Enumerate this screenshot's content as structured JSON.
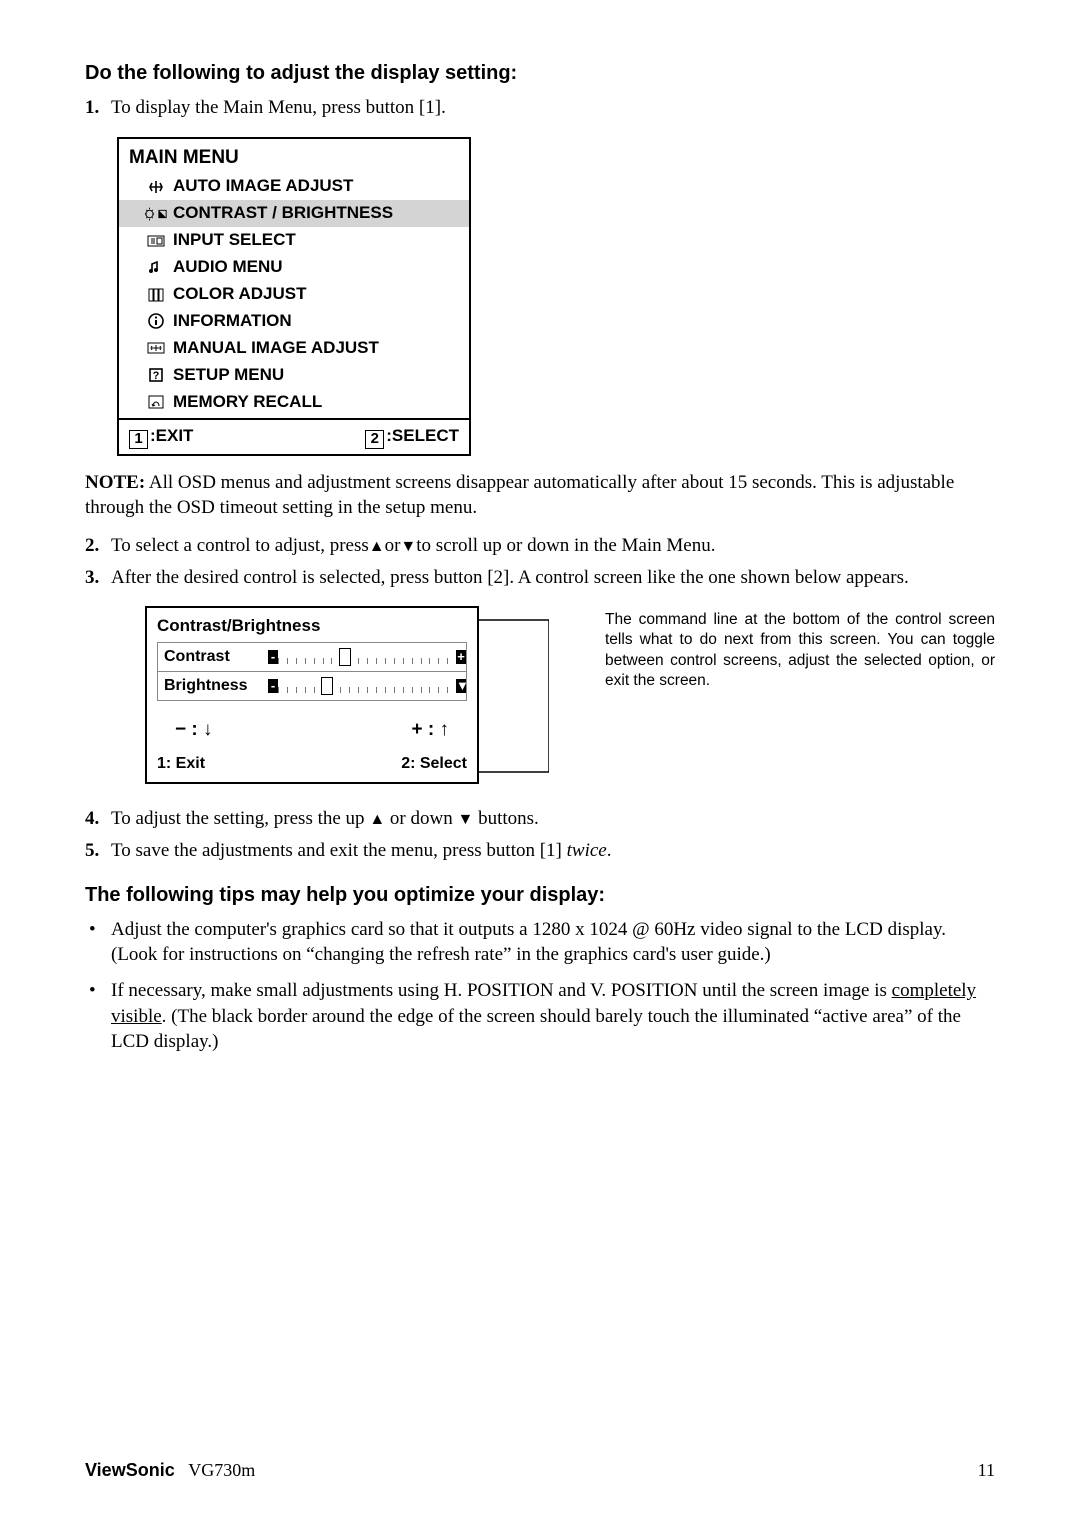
{
  "heading1": "Do the following to adjust the display setting:",
  "step1": {
    "num": "1.",
    "text": "To display the Main Menu, press button [1]."
  },
  "menu": {
    "title": "MAIN MENU",
    "items": [
      "AUTO IMAGE ADJUST",
      "CONTRAST / BRIGHTNESS",
      "INPUT SELECT",
      "AUDIO MENU",
      "COLOR ADJUST",
      "INFORMATION",
      "MANUAL IMAGE ADJUST",
      "SETUP MENU",
      "MEMORY RECALL"
    ],
    "foot_exit_key": "1",
    "foot_exit_label": ":EXIT",
    "foot_select_key": "2",
    "foot_select_label": ":SELECT"
  },
  "note_label": "NOTE:",
  "note_text": " All OSD menus and adjustment screens disappear automatically after about 15 seconds. This is adjustable through the OSD timeout setting in the setup menu.",
  "step2": {
    "num": "2.",
    "pre": "To select a control to adjust, press",
    "mid": "or",
    "post": "to scroll up or down in the Main Menu."
  },
  "step3": {
    "num": "3.",
    "text": "After the desired control is selected, press button [2]. A control screen like the one shown below appears."
  },
  "cb": {
    "title": "Contrast/Brightness",
    "row1": "Contrast",
    "row2": "Brightness",
    "minus": "− : ",
    "plus": "+ : ",
    "foot_exit": "1: Exit",
    "foot_select": "2: Select"
  },
  "cb_note": "The command line at the bottom of the control screen tells what to do next from this screen. You can toggle between control screens, adjust the selected option, or exit the screen.",
  "step4": {
    "num": "4.",
    "pre": "To adjust the setting, press the up ",
    "mid": " or down ",
    "post": " buttons."
  },
  "step5": {
    "num": "5.",
    "pre": "To save the adjustments and exit the menu, press button [1] ",
    "ital": "twice",
    "post": "."
  },
  "heading2": "The following tips may help you optimize your display:",
  "tip1": "Adjust the computer's graphics card so that it outputs a 1280 x 1024 @ 60Hz video signal to the LCD display. (Look for instructions on “changing the refresh rate” in the graphics card's user guide.)",
  "tip2_pre": "If necessary, make small adjustments using H. POSITION and V. POSITION until the screen image is ",
  "tip2_ul": "completely visible",
  "tip2_post": ". (The black border around the edge of the screen should barely touch the illuminated “active area” of the LCD display.)",
  "footer_brand": "ViewSonic",
  "footer_model": "VG730m",
  "footer_page": "11"
}
